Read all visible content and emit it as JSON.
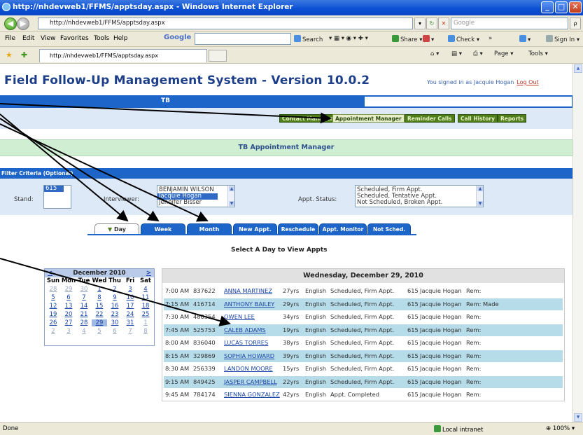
{
  "window": {
    "title": "http://nhdevweb1/FFMS/apptsday.aspx - Windows Internet Explorer",
    "controls": [
      "_",
      "□",
      "✕"
    ]
  },
  "navbar": {
    "address": "http://nhdevweb1/FFMS/apptsday.aspx",
    "search_placeholder": "Google",
    "search_btn": "ρ"
  },
  "menubar": {
    "items": [
      "File",
      "Edit",
      "View",
      "Favorites",
      "Tools",
      "Help"
    ],
    "google_label": "Google",
    "tools": [
      "Search",
      "Share",
      "Check",
      "»"
    ],
    "signin": "Sign In"
  },
  "favbar": {
    "tab_title": "http://nhdevweb1/FFMS/apptsday.aspx",
    "tools": [
      "Page",
      "Tools"
    ]
  },
  "app": {
    "title": "Field Follow-Up Management System - Version 10.0.2",
    "signed_in": "You signed in as Jacquie Hogan",
    "logout": "Log Out",
    "program": "TB",
    "nav": [
      "Contact Manager",
      "Appointment Manager",
      "Reminder Calls",
      "Call History",
      "Reports"
    ],
    "manager_title": "TB Appointment Manager",
    "filter_header": "Filter Criteria (Optional)",
    "filters": {
      "stand_label": "Stand:",
      "stand_options": [
        "615"
      ],
      "interviewer_label": "Interviewer:",
      "interviewer_options": [
        "BENJAMIN WILSON",
        "Jacquie Hogan",
        "Jennifer Bisser"
      ],
      "status_label": "Appt. Status:",
      "status_options": [
        "Scheduled, Firm Appt.",
        "Scheduled, Tentative Appt.",
        "Not Scheduled, Broken Appt."
      ]
    },
    "tabs": [
      "Day",
      "Week",
      "Month",
      "New Appt.",
      "Reschedule",
      "Appt. Monitor",
      "Not Sched."
    ],
    "select_day_text": "Select A Day to View Appts",
    "calendar": {
      "month": "December 2010",
      "prev": "<",
      "next": ">",
      "dow": [
        "Sun",
        "Mon",
        "Tue",
        "Wed",
        "Thu",
        "Fri",
        "Sat"
      ],
      "weeks": [
        [
          "28",
          "29",
          "30",
          "1",
          "2",
          "3",
          "4"
        ],
        [
          "5",
          "6",
          "7",
          "8",
          "9",
          "10",
          "11"
        ],
        [
          "12",
          "13",
          "14",
          "15",
          "16",
          "17",
          "18"
        ],
        [
          "19",
          "20",
          "21",
          "22",
          "23",
          "24",
          "25"
        ],
        [
          "26",
          "27",
          "28",
          "29",
          "30",
          "31",
          "1"
        ],
        [
          "2",
          "3",
          "4",
          "5",
          "6",
          "7",
          "8"
        ]
      ],
      "selected": "29"
    },
    "appointments": {
      "date_header": "Wednesday, December 29, 2010",
      "rows": [
        {
          "time": "7:00 AM",
          "id": "837622",
          "name": "ANNA MARTINEZ",
          "age": "27yrs",
          "lang": "English",
          "status": "Scheduled, Firm Appt.",
          "stand": "615",
          "interviewer": "Jacquie Hogan",
          "rem": "Rem:"
        },
        {
          "time": "7:15 AM",
          "id": "416714",
          "name": "ANTHONY BAILEY",
          "age": "29yrs",
          "lang": "English",
          "status": "Scheduled, Firm Appt.",
          "stand": "615",
          "interviewer": "Jacquie Hogan",
          "rem": "Rem: Made"
        },
        {
          "time": "7:30 AM",
          "id": "480354",
          "name": "OWEN LEE",
          "age": "34yrs",
          "lang": "English",
          "status": "Scheduled, Firm Appt.",
          "stand": "615",
          "interviewer": "Jacquie Hogan",
          "rem": "Rem:"
        },
        {
          "time": "7:45 AM",
          "id": "525753",
          "name": "CALEB ADAMS",
          "age": "19yrs",
          "lang": "English",
          "status": "Scheduled, Firm Appt.",
          "stand": "615",
          "interviewer": "Jacquie Hogan",
          "rem": "Rem:"
        },
        {
          "time": "8:00 AM",
          "id": "836040",
          "name": "LUCAS TORRES",
          "age": "38yrs",
          "lang": "English",
          "status": "Scheduled, Firm Appt.",
          "stand": "615",
          "interviewer": "Jacquie Hogan",
          "rem": "Rem:"
        },
        {
          "time": "8:15 AM",
          "id": "329869",
          "name": "SOPHIA HOWARD",
          "age": "39yrs",
          "lang": "English",
          "status": "Scheduled, Firm Appt.",
          "stand": "615",
          "interviewer": "Jacquie Hogan",
          "rem": "Rem:"
        },
        {
          "time": "8:30 AM",
          "id": "256339",
          "name": "LANDON MOORE",
          "age": "15yrs",
          "lang": "English",
          "status": "Scheduled, Firm Appt.",
          "stand": "615",
          "interviewer": "Jacquie Hogan",
          "rem": "Rem:"
        },
        {
          "time": "9:15 AM",
          "id": "849425",
          "name": "JASPER CAMPBELL",
          "age": "22yrs",
          "lang": "English",
          "status": "Scheduled, Firm Appt.",
          "stand": "615",
          "interviewer": "Jacquie Hogan",
          "rem": "Rem:"
        },
        {
          "time": "9:45 AM",
          "id": "784174",
          "name": "SIENNA GONZALEZ",
          "age": "42yrs",
          "lang": "English",
          "status": "Appt. Completed",
          "stand": "615",
          "interviewer": "Jacquie Hogan",
          "rem": "Rem:"
        }
      ]
    }
  },
  "statusbar": {
    "left": "Done",
    "zone": "Local intranet",
    "zoom": "100%"
  },
  "colors": {
    "accent": "#1d65c9",
    "title_blue": "#1d3f8a",
    "nav_green": "#4f7d1a",
    "row_alt": "#b6dbe9",
    "band_green": "#cfeed2"
  }
}
